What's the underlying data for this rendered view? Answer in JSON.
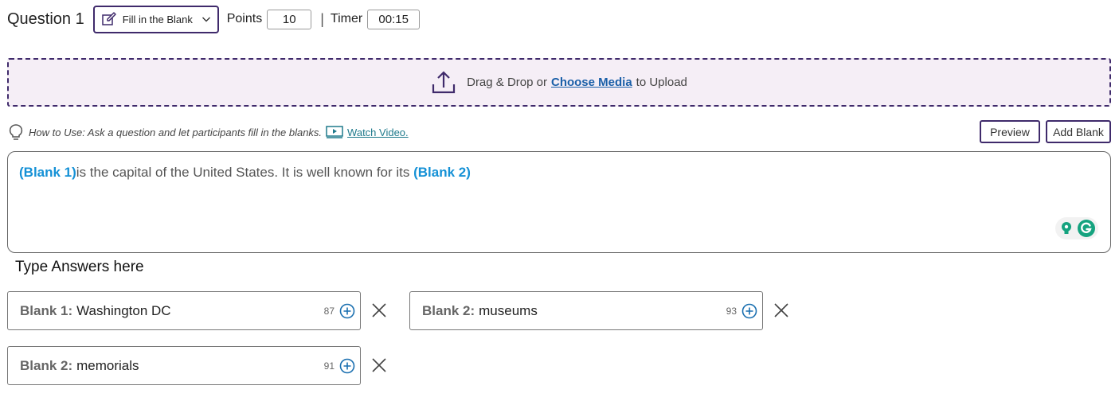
{
  "header": {
    "question_title": "Question 1",
    "question_type": "Fill in the Blank",
    "points_label": "Points",
    "points_value": "10",
    "separator": "|",
    "timer_label": "Timer",
    "timer_value": "00:15"
  },
  "upload": {
    "text_before": "Drag & Drop or",
    "link_text": "Choose Media",
    "text_after": "to Upload"
  },
  "help": {
    "text": "How to Use: Ask a question and let participants fill in the blanks.",
    "video_link": "Watch Video."
  },
  "buttons": {
    "preview": "Preview",
    "add_blank": "Add Blank"
  },
  "editor": {
    "blank1_tag": "(Blank 1)",
    "text_middle": "is the capital of the United States. It is well known for its ",
    "blank2_tag": "(Blank 2)"
  },
  "answers_heading": "Type Answers here",
  "answers": [
    {
      "label": "Blank 1:",
      "value": "Washington DC",
      "count": "87"
    },
    {
      "label": "Blank 2:",
      "value": "museums",
      "count": "93"
    },
    {
      "label": "Blank 2:",
      "value": "memorials",
      "count": "91"
    }
  ],
  "colors": {
    "accent_purple": "#3f2a6b",
    "upload_bg": "#f5eef6",
    "blank_blue": "#1591d6",
    "link_blue": "#1a5fa8",
    "teal": "#1f7a8c",
    "grammarly_green": "#15a37f"
  },
  "icons": {
    "type_select": "edit-pen-icon",
    "dropdown": "chevron-down-icon",
    "upload": "upload-arrow-icon",
    "help": "lightbulb-icon",
    "video": "video-play-icon",
    "add": "plus-circle-icon",
    "remove": "close-x-icon"
  }
}
